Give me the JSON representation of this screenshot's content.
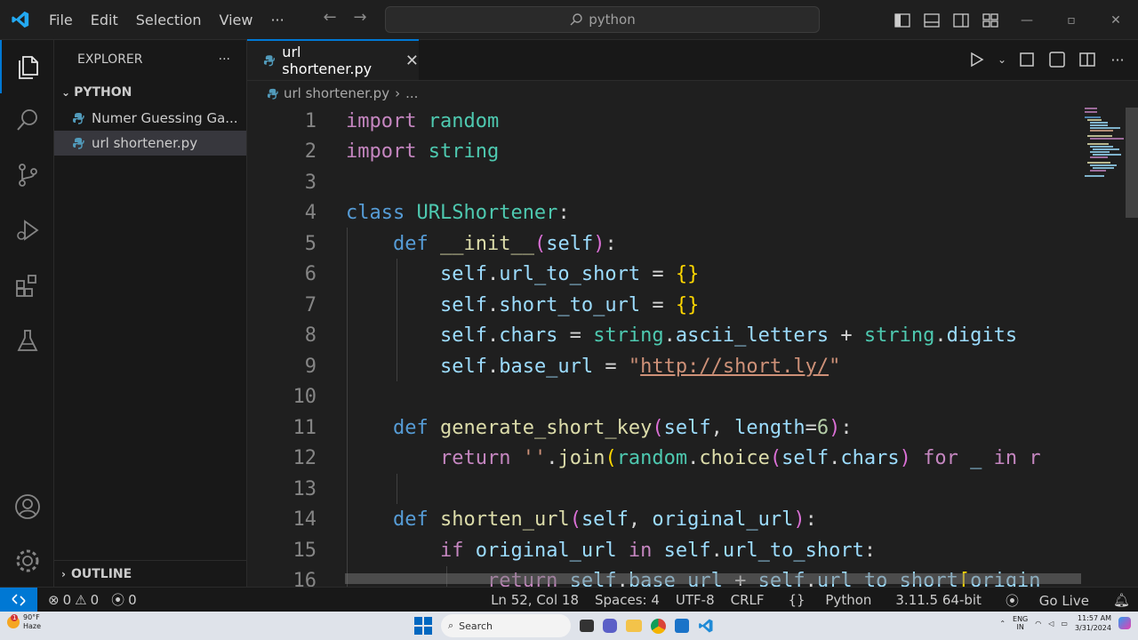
{
  "titlebar": {
    "menu": [
      "File",
      "Edit",
      "Selection",
      "View",
      "···"
    ],
    "search_text": "python"
  },
  "sidebar": {
    "title": "EXPLORER",
    "more": "···",
    "folder": "PYTHON",
    "files": [
      {
        "name": "Numer Guessing Ga...",
        "selected": false
      },
      {
        "name": "url shortener.py",
        "selected": true
      }
    ],
    "outline": "OUTLINE"
  },
  "editor": {
    "tab_label": "url shortener.py",
    "breadcrumb_file": "url shortener.py",
    "breadcrumb_more": "...",
    "line_numbers": [
      "1",
      "2",
      "3",
      "4",
      "5",
      "6",
      "7",
      "8",
      "9",
      "10",
      "11",
      "12",
      "13",
      "14",
      "15",
      "16"
    ]
  },
  "code": {
    "l1": {
      "k": "import",
      "m": "random"
    },
    "l2": {
      "k": "import",
      "m": "string"
    },
    "l4": {
      "kb": "class",
      "m": "URLShortener",
      "p": ":"
    },
    "l5": {
      "kb": "def",
      "f": "__init__",
      "v": "self"
    },
    "l6": {
      "v1": "self",
      "v2": "url_to_short",
      "eq": " = ",
      "b": "{}"
    },
    "l7": {
      "v1": "self",
      "v2": "short_to_url",
      "eq": " = ",
      "b": "{}"
    },
    "l8": {
      "v1": "self",
      "v2": "chars",
      "eq": " = ",
      "m1": "string",
      "v3": "ascii_letters",
      "plus": " + ",
      "m2": "string",
      "v4": "digits"
    },
    "l9": {
      "v1": "self",
      "v2": "base_url",
      "eq": " = ",
      "q": "\"",
      "url": "http://short.ly/"
    },
    "l11": {
      "kb": "def",
      "f": "generate_short_key",
      "v1": "self",
      "v2": "length",
      "n": "6"
    },
    "l12": {
      "k": "return",
      "s": "''",
      "f1": "join",
      "m": "random",
      "f2": "choice",
      "v1": "self",
      "v2": "chars",
      "k2": "for",
      "v3": "_",
      "k3": "in",
      "tail": "r"
    },
    "l14": {
      "kb": "def",
      "f": "shorten_url",
      "v1": "self",
      "v2": "original_url"
    },
    "l15": {
      "k": "if",
      "v1": "original_url",
      "k2": "in",
      "v2": "self",
      "v3": "url_to_short"
    },
    "l16": {
      "k": "return",
      "v1": "self",
      "v2": "base_url",
      "plus": " + ",
      "v3": "self",
      "v4": "url_to_short",
      "v5": "origin"
    }
  },
  "statusbar": {
    "errors": "0",
    "warnings": "0",
    "ports": "0",
    "position": "Ln 52, Col 18",
    "spaces": "Spaces: 4",
    "encoding": "UTF-8",
    "eol": "CRLF",
    "language": "Python",
    "interpreter": "3.11.5 64-bit",
    "golive": "Go Live"
  },
  "taskbar": {
    "temp": "90°F",
    "condition": "Haze",
    "search": "Search",
    "lang1": "ENG",
    "lang2": "IN",
    "time": "11:57 AM",
    "date": "3/31/2024",
    "badge": "1"
  },
  "colors": {
    "accent": "#0078d4",
    "keyword": "#c586c0",
    "storage": "#569cd6",
    "type": "#4ec9b0",
    "function": "#dcdcaa",
    "variable": "#9cdcfe",
    "string": "#ce9178"
  }
}
